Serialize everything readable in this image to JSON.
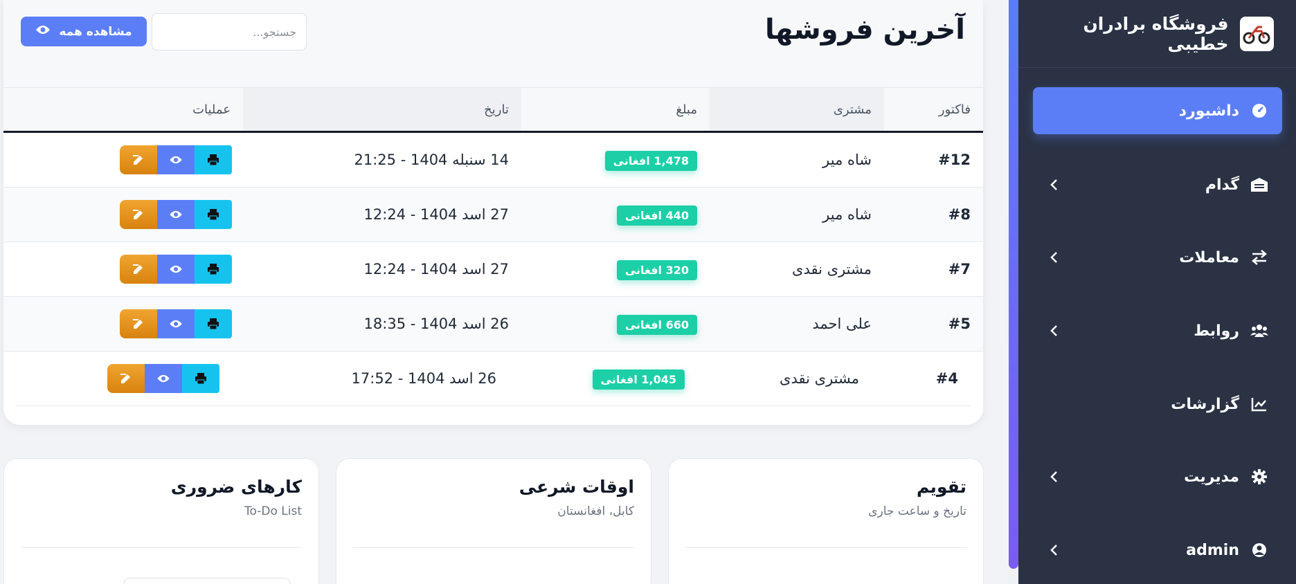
{
  "brand": {
    "name": "فروشگاه برادران خطیبی",
    "logo_icon": "motorcycle-icon"
  },
  "sidebar": {
    "items": [
      {
        "label": "داشبورد",
        "icon": "dashboard-gauge-icon",
        "active": true,
        "has_submenu": false
      },
      {
        "label": "گدام",
        "icon": "warehouse-icon",
        "active": false,
        "has_submenu": true
      },
      {
        "label": "معاملات",
        "icon": "exchange-arrows-icon",
        "active": false,
        "has_submenu": true
      },
      {
        "label": "روابط",
        "icon": "users-icon",
        "active": false,
        "has_submenu": true
      },
      {
        "label": "گزارشات",
        "icon": "chart-line-icon",
        "active": false,
        "has_submenu": false
      },
      {
        "label": "مدیریت",
        "icon": "gear-icon",
        "active": false,
        "has_submenu": true
      },
      {
        "label": "admin",
        "icon": "user-circle-icon",
        "active": false,
        "has_submenu": true
      }
    ]
  },
  "sales": {
    "title": "آخرین فروشها",
    "search_placeholder": "جستجو...",
    "view_all_label": "مشاهده همه",
    "columns": [
      "فاکتور",
      "مشتری",
      "مبلغ",
      "تاریخ",
      "عملیات"
    ],
    "rows": [
      {
        "invoice": "#12",
        "customer": "شاه میر",
        "amount": "1,478 افغانی",
        "date": "14 سنبله 1404 - 21:25"
      },
      {
        "invoice": "#8",
        "customer": "شاه میر",
        "amount": "440 افغانی",
        "date": "27 اسد 1404 - 12:24"
      },
      {
        "invoice": "#7",
        "customer": "مشتری نقدی",
        "amount": "320 افغانی",
        "date": "27 اسد 1404 - 12:24"
      },
      {
        "invoice": "#5",
        "customer": "علی احمد",
        "amount": "660 افغانی",
        "date": "26 اسد 1404 - 18:35"
      },
      {
        "invoice": "#4",
        "customer": "مشتری نقدی",
        "amount": "1,045 افغانی",
        "date": "26 اسد 1404 - 17:52"
      }
    ]
  },
  "panels": {
    "calendar": {
      "title": "تقویم",
      "subtitle": "تاریخ و ساعت جاری"
    },
    "prayer": {
      "title": "اوقات شرعی",
      "subtitle": "کابل، افغانستان"
    },
    "todo": {
      "title": "کارهای ضروری",
      "subtitle": "To-Do List"
    }
  },
  "colors": {
    "sidebar_bg": "#2a3244",
    "accent": "#5b7ef7",
    "amount_badge": "#1ccfa7",
    "edit_button": "#e8941c",
    "print_button": "#16c3ef"
  }
}
